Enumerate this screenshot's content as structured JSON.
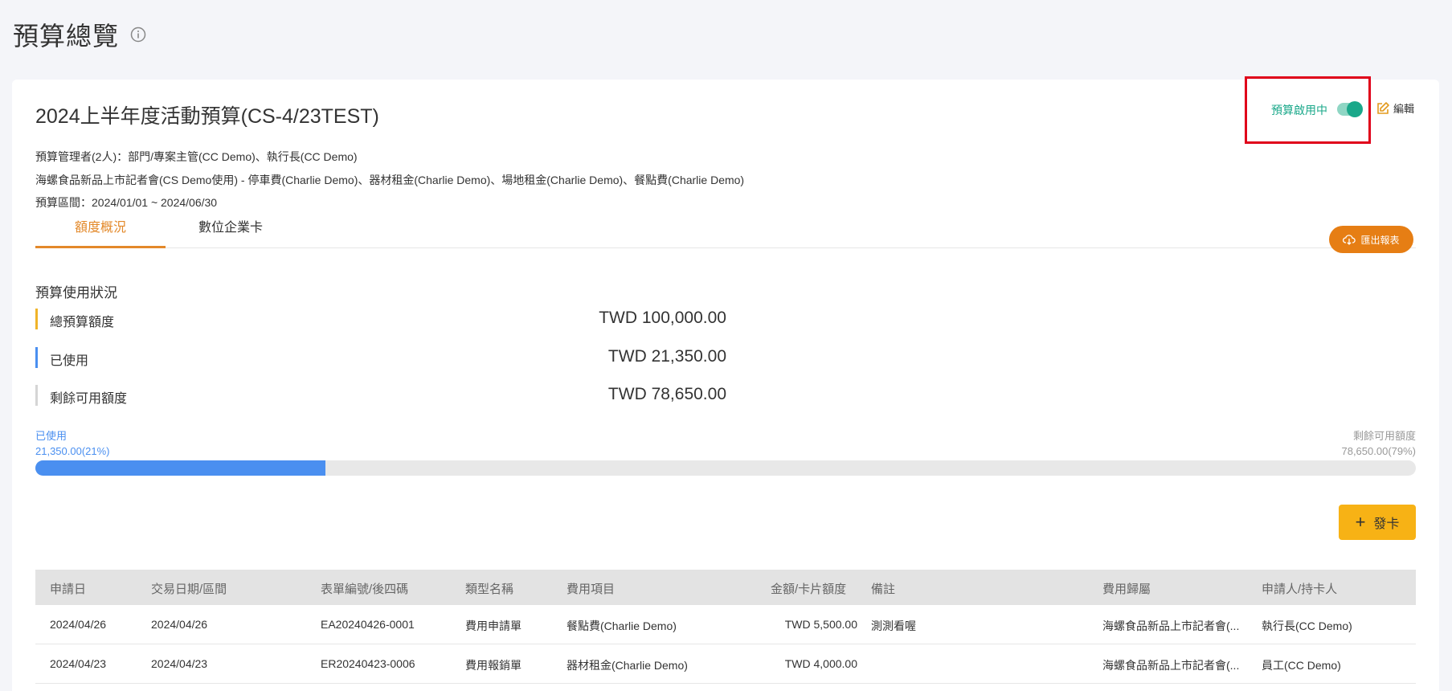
{
  "page": {
    "title": "預算總覽"
  },
  "budget": {
    "title": "2024上半年度活動預算(CS-4/23TEST)",
    "managers": "預算管理者(2人)：部門/專案主管(CC Demo)、執行長(CC Demo)",
    "scope": "海螺食品新品上市記者會(CS Demo使用) - 停車費(Charlie Demo)、器材租金(Charlie Demo)、場地租金(Charlie Demo)、餐點費(Charlie Demo)",
    "period": "預算區間：2024/01/01 ~ 2024/06/30",
    "status_label": "預算啟用中",
    "status_on": true,
    "edit_label": "編輯"
  },
  "tabs": [
    {
      "label": "額度概況",
      "active": true
    },
    {
      "label": "數位企業卡",
      "active": false
    }
  ],
  "export_label": "匯出報表",
  "usage": {
    "section_title": "預算使用狀況",
    "rows": [
      {
        "label": "總預算額度",
        "value": "TWD 100,000.00",
        "color": "#f0b429"
      },
      {
        "label": "已使用",
        "value": "TWD 21,350.00",
        "color": "#4a8ff0"
      },
      {
        "label": "剩餘可用額度",
        "value": "TWD 78,650.00",
        "color": "#d5d5d5"
      }
    ],
    "used_label": "已使用",
    "used_value": "21,350.00(21%)",
    "remaining_label": "剩餘可用額度",
    "remaining_value": "78,650.00(79%)",
    "used_percent": 21
  },
  "issue_card_label": "發卡",
  "table": {
    "headers": [
      "申請日",
      "交易日期/區間",
      "表單編號/後四碼",
      "類型名稱",
      "費用項目",
      "金額/卡片額度",
      "備註",
      "費用歸屬",
      "申請人/持卡人"
    ],
    "rows": [
      [
        "2024/04/26",
        "2024/04/26",
        "EA20240426-0001",
        "費用申請單",
        "餐點費(Charlie Demo)",
        "TWD 5,500.00",
        "測測看喔",
        "海螺食品新品上市記者會(...",
        "執行長(CC Demo)"
      ],
      [
        "2024/04/23",
        "2024/04/23",
        "ER20240423-0006",
        "費用報銷單",
        "器材租金(Charlie Demo)",
        "TWD 4,000.00",
        "",
        "海螺食品新品上市記者會(...",
        "員工(CC Demo)"
      ]
    ]
  },
  "colors": {
    "accent_orange": "#e67e14",
    "accent_green": "#1aa88a",
    "accent_blue": "#4a8ff0",
    "accent_yellow": "#f7b215"
  }
}
